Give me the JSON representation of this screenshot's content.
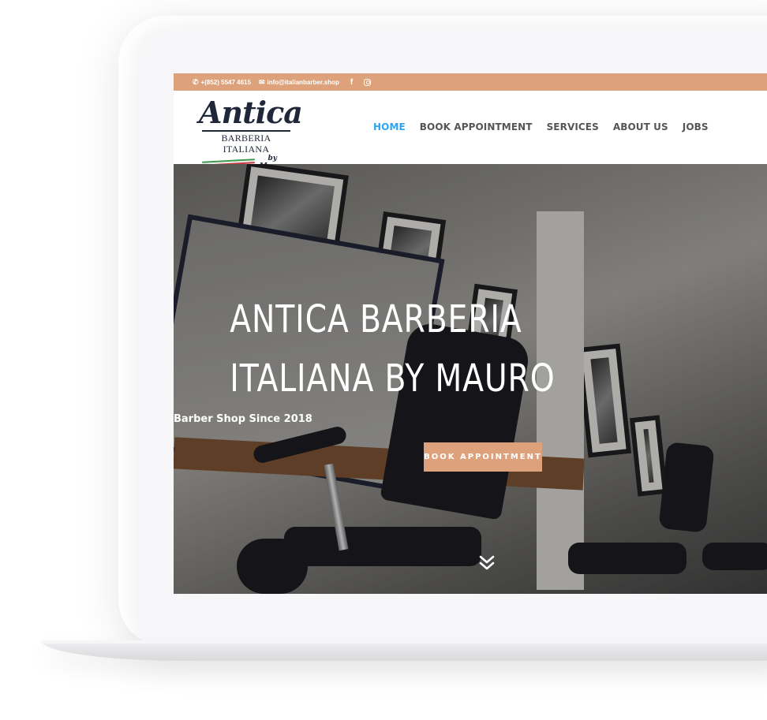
{
  "topbar": {
    "phone": "+(852) 5547 4615",
    "email": "info@italianbarber.shop",
    "icons": [
      "phone-icon",
      "envelope-icon",
      "facebook-icon",
      "instagram-icon"
    ],
    "facebook_glyph": "f",
    "phone_glyph": "✆",
    "email_glyph": "✉"
  },
  "logo": {
    "script": "Antica",
    "subtitle": "BARBERIA ITALIANA",
    "by": "by Mauro"
  },
  "nav": {
    "items": [
      {
        "label": "HOME",
        "active": true
      },
      {
        "label": "BOOK APPOINTMENT",
        "active": false
      },
      {
        "label": "SERVICES",
        "active": false
      },
      {
        "label": "ABOUT US",
        "active": false
      },
      {
        "label": "JOBS",
        "active": false
      }
    ]
  },
  "hero": {
    "title_line1": "ANTICA BARBERIA",
    "title_line2": "ITALIANA BY MAURO",
    "subtitle": "Barber Shop Since 2018",
    "button": "BOOK APPOINTMENT",
    "scroll_icon": "double-chevron-down-icon"
  },
  "colors": {
    "accent": "#dda27c",
    "nav_active": "#2ea3f2",
    "nav_text": "#555555",
    "logo_dark": "#1f2738"
  }
}
